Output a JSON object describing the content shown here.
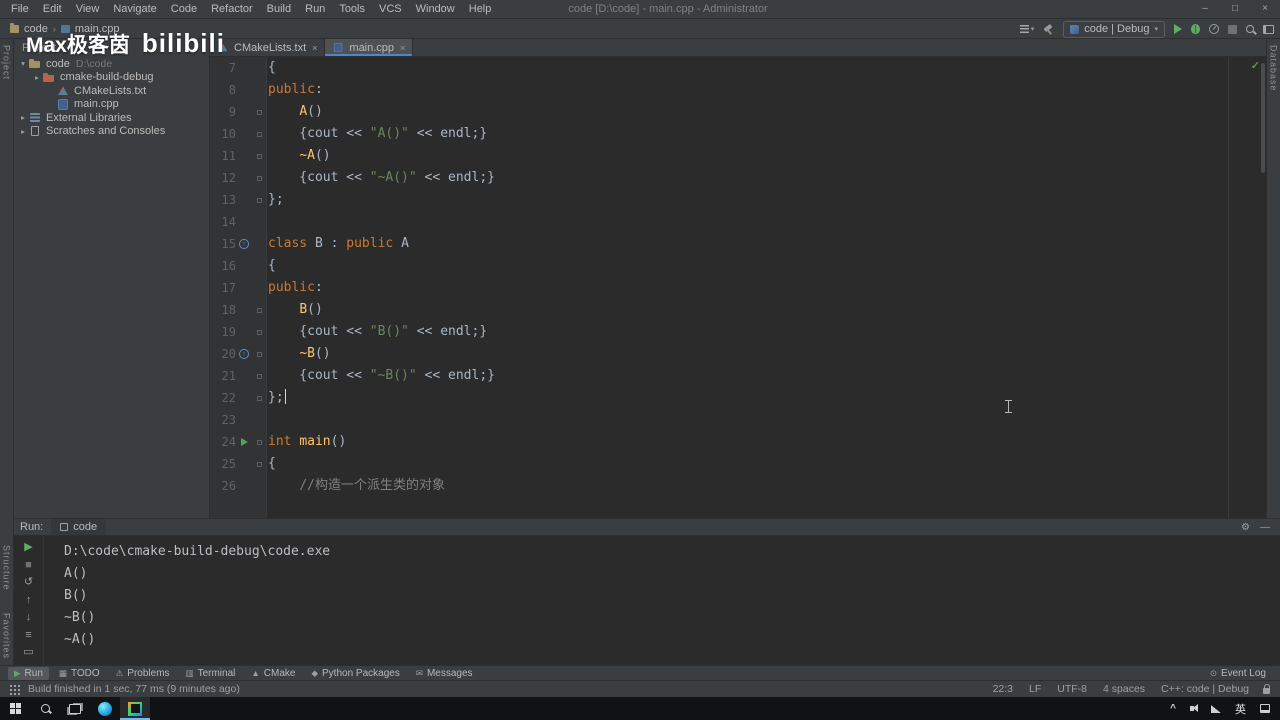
{
  "icons": {
    "separator": "›",
    "close": "×",
    "caret_down": "▾",
    "check": "✓",
    "up": "↑",
    "gear": "⚙",
    "hide": "—",
    "chevron_up": "^"
  },
  "titlebar": {
    "menus": [
      "File",
      "Edit",
      "View",
      "Navigate",
      "Code",
      "Refactor",
      "Build",
      "Run",
      "Tools",
      "VCS",
      "Window",
      "Help"
    ],
    "title": "code [D:\\code] - main.cpp - Administrator",
    "controls": [
      "–",
      "□",
      "×"
    ]
  },
  "navbar": {
    "breadcrumbs": [
      "code",
      "main.cpp"
    ],
    "run_config": "code | Debug"
  },
  "watermark": {
    "brand1": "Max极客茵",
    "brand2": "bilibili"
  },
  "tabs": [
    {
      "label": "CMakeLists.txt",
      "icon": "cmake",
      "active": false
    },
    {
      "label": "main.cpp",
      "icon": "cpp",
      "active": true
    }
  ],
  "left_stripe": {
    "top": [
      "Project"
    ],
    "bottom": [
      "Structure",
      "Favorites"
    ]
  },
  "right_stripe": [
    "Database"
  ],
  "project": {
    "header": "Project"
  },
  "project_tree": [
    {
      "level": 0,
      "arrow": "▾",
      "icon": "folder",
      "label": "code",
      "hint": "D:\\code"
    },
    {
      "level": 1,
      "arrow": "▸",
      "icon": "folder-excluded",
      "label": "cmake-build-debug",
      "hint": ""
    },
    {
      "level": 2,
      "arrow": "",
      "icon": "cmake",
      "label": "CMakeLists.txt",
      "hint": ""
    },
    {
      "level": 2,
      "arrow": "",
      "icon": "cpp",
      "label": "main.cpp",
      "hint": ""
    },
    {
      "level": 0,
      "arrow": "▸",
      "icon": "library",
      "label": "External Libraries",
      "hint": ""
    },
    {
      "level": 0,
      "arrow": "▸",
      "icon": "scratch",
      "label": "Scratches and Consoles",
      "hint": ""
    }
  ],
  "editor": {
    "inspection_glyph": "✓",
    "lines": [
      {
        "n": 7,
        "t": [
          [
            "{",
            "p"
          ]
        ]
      },
      {
        "n": 8,
        "t": [
          [
            "public",
            "k"
          ],
          [
            ":",
            "p"
          ]
        ]
      },
      {
        "n": 9,
        "f": true,
        "t": [
          [
            "    ",
            "p"
          ],
          [
            "A",
            "f"
          ],
          [
            "()",
            "p"
          ]
        ]
      },
      {
        "n": 10,
        "f": true,
        "t": [
          [
            "    {cout << ",
            "p"
          ],
          [
            "\"A()\"",
            "s"
          ],
          [
            " << endl;}",
            "p"
          ]
        ]
      },
      {
        "n": 11,
        "f": true,
        "t": [
          [
            "    ",
            "p"
          ],
          [
            "~A",
            "f"
          ],
          [
            "()",
            "p"
          ]
        ]
      },
      {
        "n": 12,
        "f": true,
        "t": [
          [
            "    {cout << ",
            "p"
          ],
          [
            "\"~A()\"",
            "s"
          ],
          [
            " << endl;}",
            "p"
          ]
        ]
      },
      {
        "n": 13,
        "f": true,
        "t": [
          [
            "};",
            "p"
          ]
        ]
      },
      {
        "n": 14,
        "t": []
      },
      {
        "n": 15,
        "g": "ovr",
        "t": [
          [
            "class",
            "k"
          ],
          [
            " B : ",
            "p"
          ],
          [
            "public",
            "k"
          ],
          [
            " A",
            "p"
          ]
        ]
      },
      {
        "n": 16,
        "t": [
          [
            "{",
            "p"
          ]
        ]
      },
      {
        "n": 17,
        "t": [
          [
            "public",
            "k"
          ],
          [
            ":",
            "p"
          ]
        ]
      },
      {
        "n": 18,
        "f": true,
        "t": [
          [
            "    ",
            "p"
          ],
          [
            "B",
            "f"
          ],
          [
            "()",
            "p"
          ]
        ]
      },
      {
        "n": 19,
        "f": true,
        "t": [
          [
            "    {cout << ",
            "p"
          ],
          [
            "\"B()\"",
            "s"
          ],
          [
            " << endl;}",
            "p"
          ]
        ]
      },
      {
        "n": 20,
        "g": "ovr",
        "f": true,
        "t": [
          [
            "    ",
            "p"
          ],
          [
            "~B",
            "f"
          ],
          [
            "()",
            "p"
          ]
        ]
      },
      {
        "n": 21,
        "f": true,
        "t": [
          [
            "    {cout << ",
            "p"
          ],
          [
            "\"~B()\"",
            "s"
          ],
          [
            " << endl;}",
            "p"
          ]
        ]
      },
      {
        "n": 22,
        "f": true,
        "caret": true,
        "t": [
          [
            "};",
            "p"
          ]
        ]
      },
      {
        "n": 23,
        "t": []
      },
      {
        "n": 24,
        "g": "run",
        "f": true,
        "t": [
          [
            "int ",
            "k"
          ],
          [
            "main",
            "f"
          ],
          [
            "()",
            "p"
          ]
        ]
      },
      {
        "n": 25,
        "f": true,
        "t": [
          [
            "{",
            "p"
          ]
        ]
      },
      {
        "n": 26,
        "t": [
          [
            "    ",
            "p"
          ],
          [
            "//构造一个派生类的对象",
            "c"
          ]
        ]
      }
    ]
  },
  "run_panel": {
    "label": "Run:",
    "tab": "code",
    "toolbar": [
      {
        "name": "rerun-icon",
        "glyph": "▶",
        "color": "#5fad65"
      },
      {
        "name": "stop-icon",
        "glyph": "■",
        "color": "#6f7274"
      },
      {
        "name": "restore-layout-icon",
        "glyph": "↺",
        "color": "#9a9da0"
      },
      {
        "name": "up-stack-trace-icon",
        "glyph": "↑",
        "color": "#9a9da0"
      },
      {
        "name": "down-stack-trace-icon",
        "glyph": "↓",
        "color": "#9a9da0"
      },
      {
        "name": "soft-wrap-icon",
        "glyph": "≡",
        "color": "#9a9da0"
      },
      {
        "name": "clear-console-icon",
        "glyph": "▭",
        "color": "#9a9da0"
      }
    ],
    "output": [
      "D:\\code\\cmake-build-debug\\code.exe",
      "A()",
      "B()",
      "~B()",
      "~A()"
    ]
  },
  "toolwindow_bar": {
    "left": [
      {
        "label": "Run",
        "glyph": "▶",
        "color": "#5fad65",
        "active": true
      },
      {
        "label": "TODO",
        "glyph": "▦"
      },
      {
        "label": "Problems",
        "glyph": "⚠"
      },
      {
        "label": "Terminal",
        "glyph": "▥"
      },
      {
        "label": "CMake",
        "glyph": "▲"
      },
      {
        "label": "Python Packages",
        "glyph": "◆"
      },
      {
        "label": "Messages",
        "glyph": "✉"
      }
    ],
    "right": [
      {
        "label": "Event Log",
        "glyph": "⊙"
      }
    ]
  },
  "statusbar": {
    "message": "Build finished in 1 sec, 77 ms (9 minutes ago)",
    "right": [
      "22:3",
      "LF",
      "UTF-8",
      "4 spaces",
      "C++: code | Debug"
    ]
  },
  "taskbar": {
    "input_lang": "英"
  },
  "palette": {
    "accent": "#4a88c7",
    "keyword": "#cc7832",
    "function": "#ffc66d",
    "string": "#6a8759",
    "comment": "#808080",
    "text": "#a9b7c6",
    "run_green": "#5fad65",
    "bg_editor": "#2b2b2b",
    "bg_panel": "#3b3e40"
  }
}
